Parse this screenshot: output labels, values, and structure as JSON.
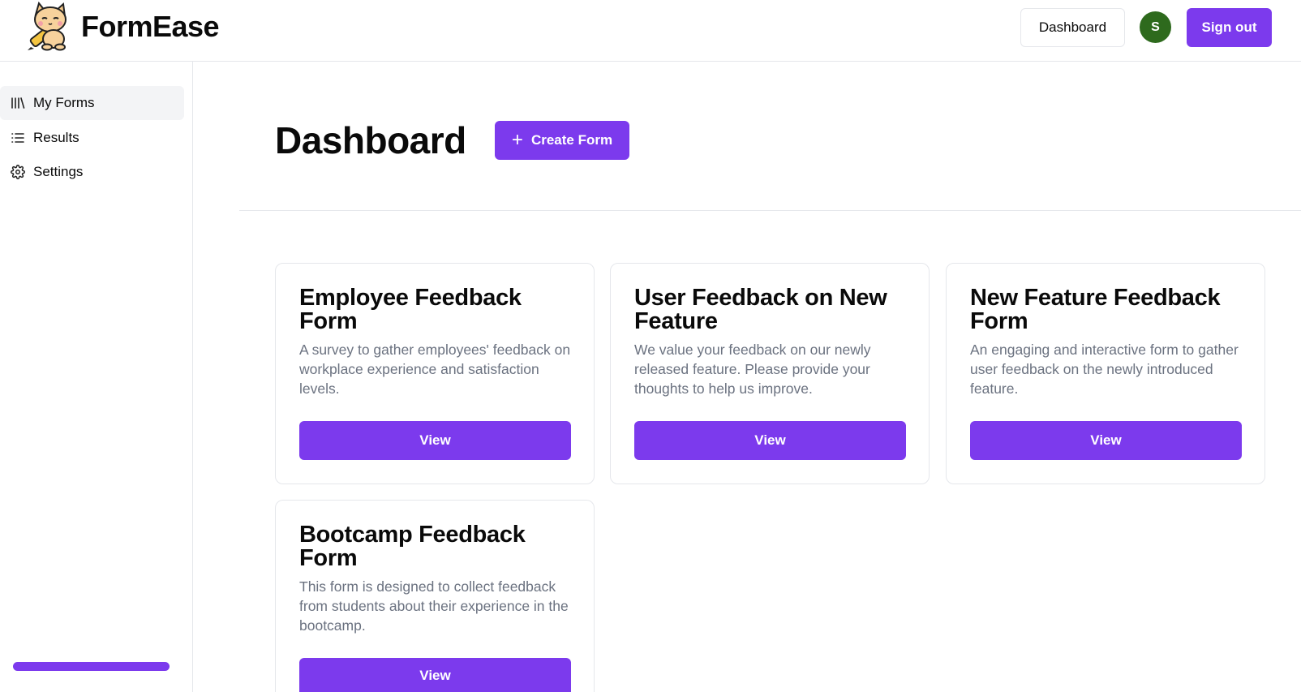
{
  "brand": {
    "name": "FormEase",
    "logo_icon": "cat-mascot-icon"
  },
  "header": {
    "dashboard_label": "Dashboard",
    "avatar_initial": "S",
    "avatar_color": "#2e6a1d",
    "signout_label": "Sign out"
  },
  "sidebar": {
    "items": [
      {
        "label": "My Forms",
        "icon": "library-icon",
        "active": true
      },
      {
        "label": "Results",
        "icon": "list-icon",
        "active": false
      },
      {
        "label": "Settings",
        "icon": "gear-icon",
        "active": false
      }
    ]
  },
  "main": {
    "title": "Dashboard",
    "create_label": "Create Form",
    "forms": [
      {
        "title": "Employee Feedback Form",
        "description": "A survey to gather employees' feedback on workplace experience and satisfaction levels.",
        "button": "View"
      },
      {
        "title": "User Feedback on New Feature",
        "description": "We value your feedback on our newly released feature. Please provide your thoughts to help us improve.",
        "button": "View"
      },
      {
        "title": "New Feature Feedback Form",
        "description": "An engaging and interactive form to gather user feedback on the newly introduced feature.",
        "button": "View"
      },
      {
        "title": "Bootcamp Feedback Form",
        "description": "This form is designed to collect feedback from students about their experience in the bootcamp.",
        "button": "View"
      }
    ]
  },
  "colors": {
    "accent": "#7c3aed",
    "muted_text": "#6b7280",
    "border": "#e5e7eb"
  }
}
